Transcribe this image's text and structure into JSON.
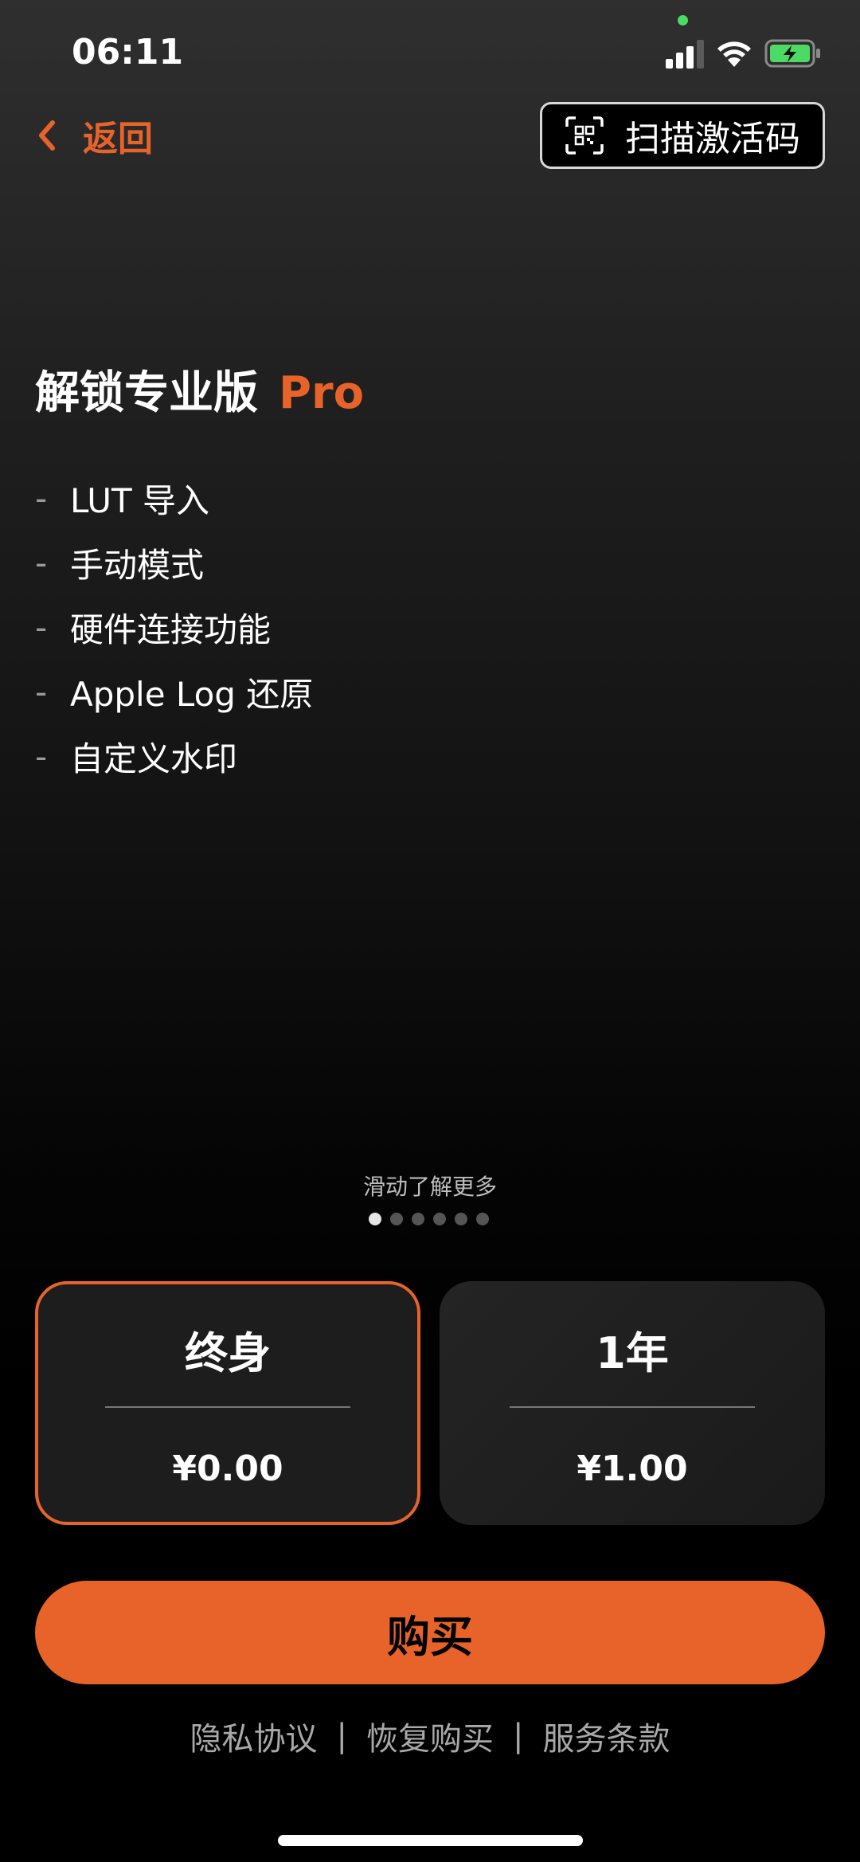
{
  "status_bar": {
    "time": "06:11"
  },
  "nav": {
    "back_label": "返回",
    "scan_label": "扫描激活码"
  },
  "title": {
    "main": "解锁专业版",
    "pro": "Pro"
  },
  "features": [
    {
      "dash": "-",
      "label": "LUT 导入"
    },
    {
      "dash": "-",
      "label": "手动模式"
    },
    {
      "dash": "-",
      "label": "硬件连接功能"
    },
    {
      "dash": "-",
      "label": "Apple Log 还原"
    },
    {
      "dash": "-",
      "label": "自定义水印"
    }
  ],
  "pager": {
    "hint": "滑动了解更多",
    "count": 6,
    "active_index": 0
  },
  "plans": [
    {
      "name": "终身",
      "price": "¥0.00",
      "selected": true
    },
    {
      "name": "1年",
      "price": "¥1.00",
      "selected": false
    }
  ],
  "buy_label": "购买",
  "footer": {
    "privacy": "隐私协议",
    "restore": "恢复购买",
    "terms": "服务条款",
    "separator": "|"
  },
  "colors": {
    "accent": "#e8632a",
    "background": "#000000",
    "card": "#1d1d1d"
  }
}
